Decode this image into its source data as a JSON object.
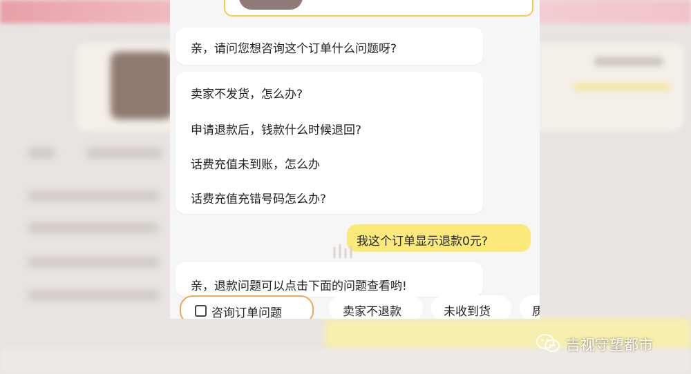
{
  "chat": {
    "greeting": "亲，请问您想咨询这个订单什么问题呀?",
    "faq": [
      "卖家不发货，怎么办?",
      "申请退款后，钱款什么时候退回?",
      "话费充值未到账，怎么办",
      "话费充值充错号码怎么办?"
    ],
    "user_message": "我这个订单显示退款0元?",
    "reply": "亲，退款问题可以点击下面的问题查看哟!",
    "quick_replies": {
      "consult_order": "咨询订单问题",
      "seller_no_refund": "卖家不退款",
      "not_received": "未收到货",
      "more": "质"
    }
  },
  "watermark": {
    "text": "吉视守望都市",
    "icon": "wechat-icon"
  },
  "colors": {
    "user_bubble": "#fbe97a",
    "highlight_border": "#f0a55a",
    "card_border": "#f2cd4f"
  }
}
